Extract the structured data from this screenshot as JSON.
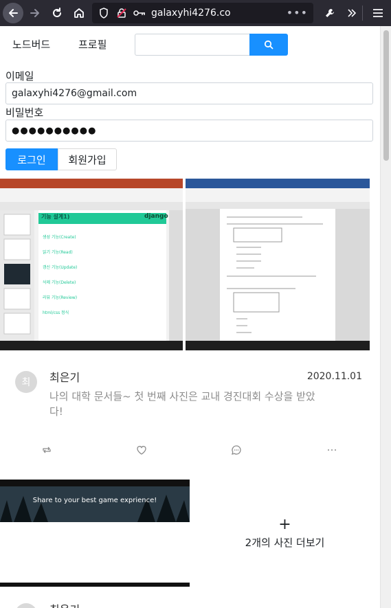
{
  "browser": {
    "url": "galaxyhi4276.co"
  },
  "nav": {
    "link1": "노드버드",
    "link2": "프로필"
  },
  "search": {
    "placeholder": ""
  },
  "login": {
    "email_label": "이메일",
    "email_value": "galaxyhi4276@gmail.com",
    "password_label": "비밀번호",
    "password_value": "●●●●●●●●●●",
    "login_button": "로그인",
    "join_button": "회원가입"
  },
  "post1": {
    "avatar_initial": "최",
    "author": "최은기",
    "date": "2020.11.01",
    "content": "나의 대학 문서들~ 첫 번째 사진은 교내 경진대회 수상을 받았다!",
    "image_left_heading": "기능 설계1)",
    "image_left_brand": "django",
    "image_left_items": [
      "생성 기능(Create)",
      "읽기 기능(Read)",
      "갱신 기능(Update)",
      "삭제 기능(Delete)",
      "리뷰 기능(Review)",
      "html/css 정식"
    ]
  },
  "post2": {
    "image_banner_text": "Share to your best game exprience!",
    "more_photos": "2개의 사진 더보기",
    "more_plus": "+",
    "author": "최은기"
  },
  "colors": {
    "primary": "#1890ff",
    "muted_text": "#8c8c8c"
  }
}
